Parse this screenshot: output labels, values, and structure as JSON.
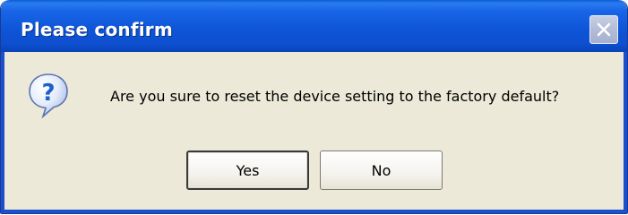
{
  "dialog": {
    "title": "Please confirm",
    "message": "Are you sure to reset the device setting to the factory default?",
    "icon": "question-icon",
    "buttons": {
      "yes_label": "Yes",
      "no_label": "No"
    },
    "close_icon": "close-icon"
  },
  "colors": {
    "titlebar": "#0f55d8",
    "title_text": "#ffffff",
    "body_background": "#ece9d8",
    "icon_blue": "#1f5fc8"
  }
}
